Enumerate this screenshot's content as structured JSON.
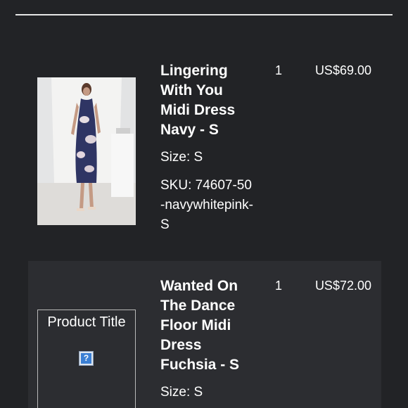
{
  "items": [
    {
      "title": "Lingering With You Midi Dress Navy - S",
      "size": "Size: S",
      "sku": "SKU: 74607-50-navywhitepink-S",
      "quantity": "1",
      "price": "US$69.00"
    },
    {
      "title": "Wanted On The Dance Floor Midi Dress Fuchsia - S",
      "size": "Size: S",
      "quantity": "1",
      "price": "US$72.00",
      "image_alt": "Product Title"
    }
  ],
  "icons": {
    "broken_image": "broken-image-icon"
  },
  "colors": {
    "background": "#222326",
    "highlight_row": "#2c2d31",
    "divider": "#e6e6e6"
  }
}
